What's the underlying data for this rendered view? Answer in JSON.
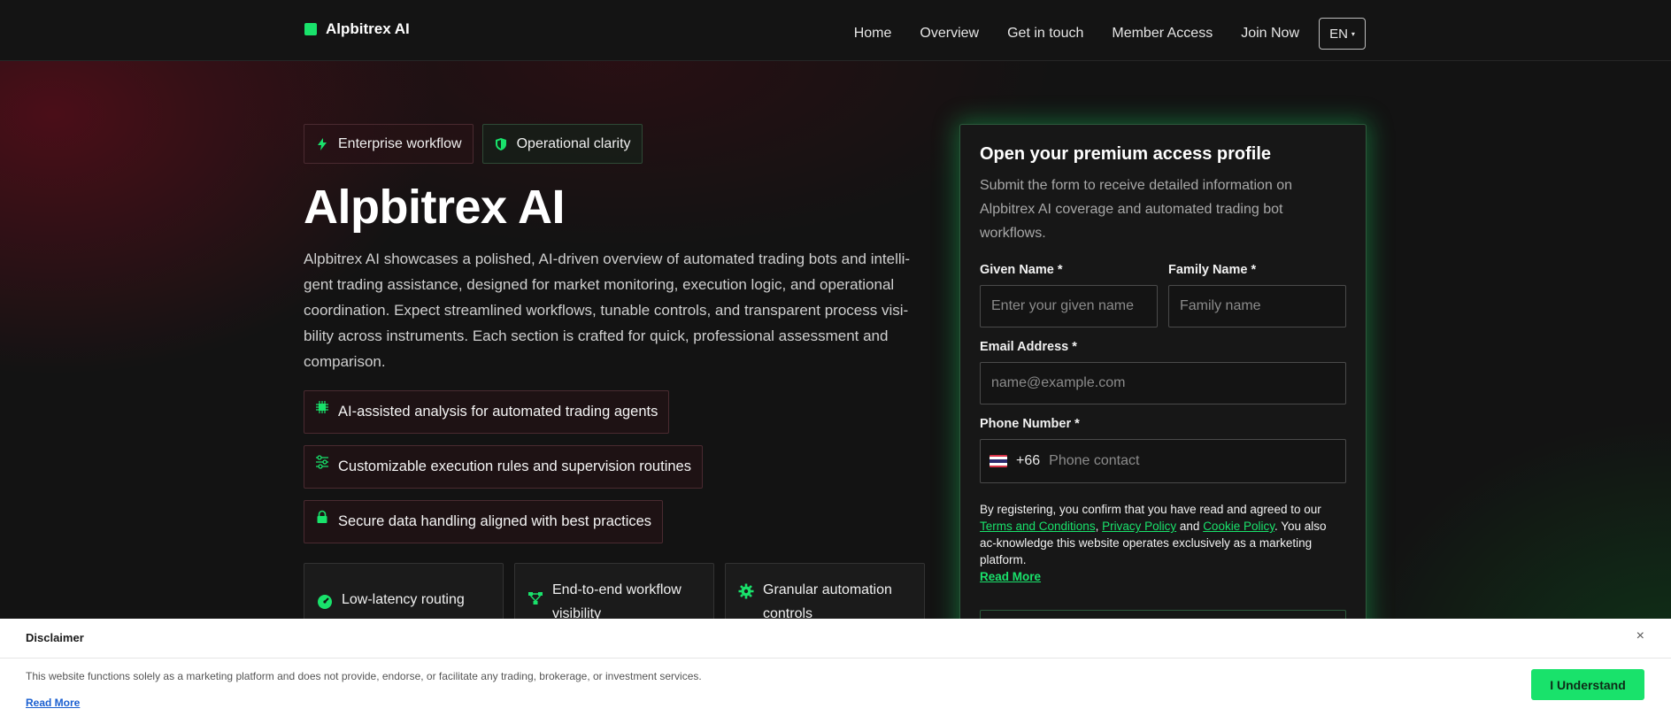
{
  "header": {
    "brand": "Alpbitrex AI",
    "nav": [
      "Home",
      "Overview",
      "Get in touch",
      "Member Access",
      "Join Now"
    ],
    "lang": "EN"
  },
  "hero": {
    "chips": [
      "Enterprise workflow",
      "Operational clarity"
    ],
    "title": "Alpbitrex AI",
    "description": "Alpbitrex AI showcases a polished, AI-driven overview of automated trading bots and intelli-gent trading assistance, designed for market monitoring, execution logic, and operational coordination. Expect streamlined workflows, tunable controls, and transparent process visi-bility across instruments. Each section is crafted for quick, professional assessment and comparison.",
    "features": [
      "AI-assisted analysis for automated trading agents",
      "Customizable execution rules and supervision routines",
      "Secure data handling aligned with best practices"
    ],
    "cards": [
      "Low-latency routing",
      "End-to-end workflow visibility",
      "Granular automation controls"
    ]
  },
  "form": {
    "title": "Open your premium access profile",
    "subtitle": "Submit the form to receive detailed information on Alpbitrex AI coverage and automated trading bot workflows.",
    "given_label": "Given Name *",
    "given_placeholder": "Enter your given name",
    "family_label": "Family Name *",
    "family_placeholder": "Family name",
    "email_label": "Email Address *",
    "email_placeholder": "name@example.com",
    "phone_label": "Phone Number *",
    "dial_code": "+66",
    "phone_placeholder": "Phone contact",
    "consent_prefix": "By registering, you confirm that you have read and agreed to our",
    "terms": "Terms and Conditions",
    "privacy": "Privacy Policy",
    "and": "and",
    "cookie": "Cookie Policy",
    "consent_suffix": ". You also ac-knowledge this website operates exclusively as a marketing platform.",
    "read_more": "Read More"
  },
  "disclaimer": {
    "title": "Disclaimer",
    "text": "This website functions solely as a marketing platform and does not provide, endorse, or facilitate any trading, brokerage, or investment services.",
    "link": "Read More",
    "button": "I Understand",
    "close": "×"
  },
  "colors": {
    "accent": "#19e26b",
    "background": "#131313",
    "card": "#1b1b1b"
  }
}
